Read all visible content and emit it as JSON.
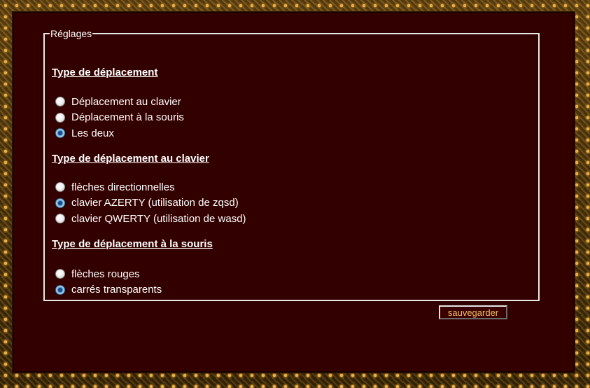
{
  "settings": {
    "legend": "Réglages",
    "movement_type": {
      "title": "Type de déplacement",
      "options": [
        {
          "label": "Déplacement au clavier",
          "checked": false
        },
        {
          "label": "Déplacement à la souris",
          "checked": false
        },
        {
          "label": "Les deux",
          "checked": true
        }
      ]
    },
    "keyboard_type": {
      "title": "Type de déplacement au clavier",
      "options": [
        {
          "label": "flèches directionnelles",
          "checked": false
        },
        {
          "label": "clavier AZERTY (utilisation de zqsd)",
          "checked": true
        },
        {
          "label": "clavier QWERTY (utilisation de wasd)",
          "checked": false
        }
      ]
    },
    "mouse_type": {
      "title": "Type de déplacement à la souris",
      "options": [
        {
          "label": "flèches rouges",
          "checked": false
        },
        {
          "label": "carrés transparents",
          "checked": true
        }
      ]
    },
    "save_label": "sauvegarder"
  },
  "colors": {
    "panel_background": "#330000",
    "text": "#ffffff",
    "button_text": "#f0c060",
    "radio_selected": "#1a4f8a"
  }
}
